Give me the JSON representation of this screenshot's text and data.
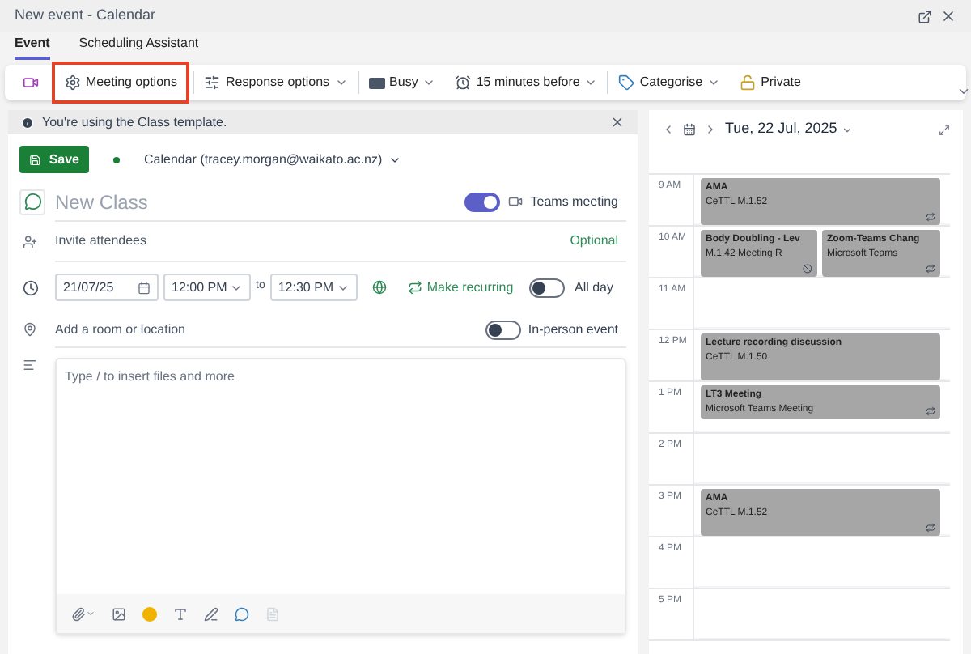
{
  "window": {
    "title": "New event - Calendar"
  },
  "tabs": [
    {
      "label": "Event",
      "selected": true
    },
    {
      "label": "Scheduling Assistant",
      "selected": false
    }
  ],
  "toolbar": [
    {
      "kind": "video",
      "highlighted": false
    },
    {
      "kind": "gear",
      "label": "Meeting options",
      "highlighted": true
    },
    {
      "kind": "sliders",
      "label": "Response options",
      "highlighted": false
    },
    {
      "kind": "busy",
      "label": "Busy",
      "highlighted": false
    },
    {
      "kind": "alarm",
      "label": "15 minutes before",
      "highlighted": false
    },
    {
      "kind": "tag",
      "label": "Categorise",
      "highlighted": false
    },
    {
      "kind": "lock",
      "label": "Private",
      "highlighted": false
    }
  ],
  "banner": {
    "text": "You're using the Class template."
  },
  "save": {
    "label": "Save"
  },
  "calendar_picker": {
    "label": "Calendar (tracey.morgan@waikato.ac.nz)"
  },
  "title_field": {
    "placeholder": "New Class"
  },
  "teams": {
    "label": "Teams meeting",
    "on": true
  },
  "attendees": {
    "placeholder": "Invite attendees",
    "optional": "Optional"
  },
  "date": {
    "value": "21/07/25"
  },
  "start_time": {
    "value": "12:00 PM"
  },
  "to": "to",
  "end_time": {
    "value": "12:30 PM"
  },
  "recurring": {
    "label": "Make recurring"
  },
  "all_day": {
    "label": "All day",
    "on": false
  },
  "location": {
    "placeholder": "Add a room or location"
  },
  "in_person": {
    "label": "In-person event",
    "on": false
  },
  "body": {
    "placeholder": "Type / to insert files and more"
  },
  "day_view": {
    "date": "Tue, 22 Jul, 2025",
    "hours": [
      "9 AM",
      "10 AM",
      "11 AM",
      "12 PM",
      "1 PM",
      "2 PM",
      "3 PM",
      "4 PM",
      "5 PM"
    ],
    "events": [
      {
        "title": "AMA",
        "subtitle": "CeTTL M.1.52",
        "kind": "recurring"
      },
      {
        "title": "Body Doubling - Lev",
        "subtitle": "M.1.42 Meeting R",
        "kind": "exception"
      },
      {
        "title": "Zoom-Teams Chang",
        "subtitle": "Microsoft Teams",
        "kind": "recurring"
      },
      {
        "title": "Lecture recording discussion",
        "subtitle": "CeTTL M.1.50",
        "kind": "single"
      },
      {
        "title": "LT3 Meeting",
        "subtitle": "Microsoft Teams Meeting",
        "kind": "recurring"
      },
      {
        "title": "AMA",
        "subtitle": "CeTTL M.1.52",
        "kind": "recurring"
      }
    ]
  }
}
